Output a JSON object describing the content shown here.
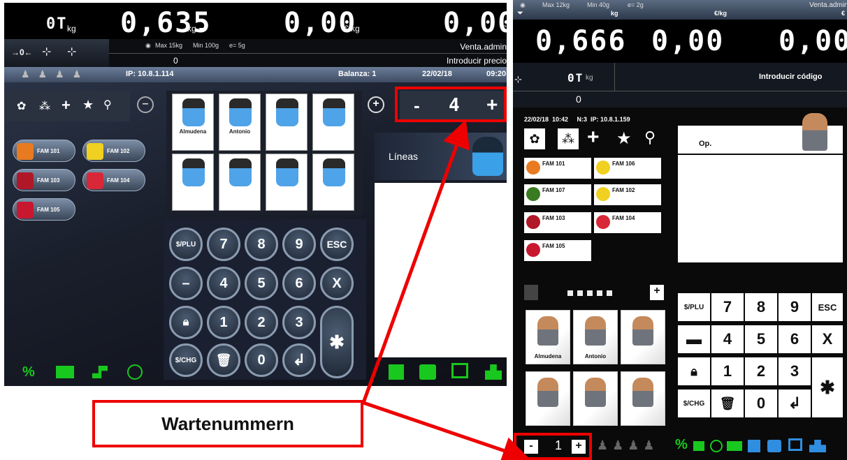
{
  "left": {
    "tare": "0T",
    "tare_unit": "kg",
    "weight": "0,635",
    "weight_unit": "kg",
    "price": "0,00",
    "price_unit": "€/kg",
    "total": "0,00",
    "total_unit": "€",
    "max": "Max 15kg",
    "min": "Min 100g",
    "e": "e= 5g",
    "user": "Venta.admin",
    "zero": "0",
    "prompt": "Introducir precio",
    "ip": "IP: 10.8.1.114",
    "scale": "Balanza: 1",
    "date": "22/02/18",
    "time": "09:20",
    "families": [
      "FAM 101",
      "FAM 102",
      "FAM 103",
      "FAM 104",
      "FAM 105"
    ],
    "operators": [
      "Almudena",
      "Antonio",
      "",
      "",
      "",
      "",
      "",
      ""
    ],
    "lines_label": "Líneas",
    "wait_minus": "-",
    "wait_number": "4",
    "wait_plus": "+",
    "keys": {
      "plu": "$/PLU",
      "k7": "7",
      "k8": "8",
      "k9": "9",
      "esc": "ESC",
      "minus": "–",
      "k4": "4",
      "k5": "5",
      "k6": "6",
      "x": "X",
      "k1": "1",
      "k2": "2",
      "k3": "3",
      "star": "✱",
      "k0": "0"
    },
    "bottom": {
      "percent": "%"
    }
  },
  "right": {
    "max": "Max 12kg",
    "min": "Min 40g",
    "e": "e= 2g",
    "user": "Venta.admin",
    "weight_unit": "kg",
    "price_unit": "€/kg",
    "total_unit": "€",
    "weight": "0,666",
    "price": "0,00",
    "total": "0,00",
    "tare": "0T",
    "tare_unit": "kg",
    "prompt": "Introducir código",
    "zero": "0",
    "info": "22/02/18  10:42     N:3  IP: 10.8.1.159",
    "families": [
      "FAM 101",
      "FAM 106",
      "FAM 107",
      "FAM 102",
      "FAM 103",
      "FAM 104",
      "FAM 105"
    ],
    "op_label": "Op.",
    "operators": [
      "Almudena",
      "Antonio",
      "",
      "",
      "",
      ""
    ],
    "keys": {
      "k7": "7",
      "k8": "8",
      "k9": "9",
      "esc": "ESC",
      "k4": "4",
      "k5": "5",
      "k6": "6",
      "x": "X",
      "k1": "1",
      "k2": "2",
      "k3": "3",
      "star": "✱",
      "k0": "0"
    },
    "wait_minus": "-",
    "wait_number": "1",
    "wait_plus": "+",
    "percent": "%"
  },
  "annotation": {
    "label": "Wartenummern"
  },
  "colors": {
    "annotation_red": "#e00000",
    "green": "#19c81e",
    "blue": "#2f8ee0"
  }
}
